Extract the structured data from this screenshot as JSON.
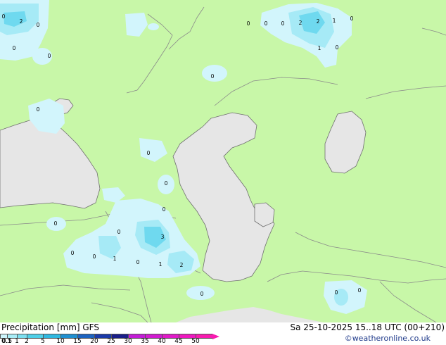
{
  "footer": {
    "title": "Precipitation [mm] GFS",
    "valid": "Sa 25-10-2025 15..18 UTC (00+210)",
    "credit": "©weatheronline.co.uk"
  },
  "legend": {
    "labels": [
      "0.1",
      "0.5",
      "1",
      "2",
      "5",
      "10",
      "15",
      "20",
      "25",
      "30",
      "35",
      "40",
      "45",
      "50"
    ],
    "colors": [
      "#cdf4fb",
      "#a9ecf6",
      "#7ddff0",
      "#4fcfe8",
      "#2fb8e0",
      "#1f8fd0",
      "#1c63c0",
      "#1a3aa8",
      "#1a1e88",
      "#c31dd6",
      "#d11bd0",
      "#e01ac8",
      "#ee19bf",
      "#f81bb0"
    ]
  },
  "colors": {
    "land": "#c8f7a8",
    "sea": "#e6e6e6",
    "border": "#8a8a8a",
    "precip_light": "#d2f5fc",
    "precip_mid": "#a6eaf6",
    "precip_heavy": "#6fd9ef"
  },
  "map": {
    "values": [
      {
        "v": "0"
      },
      {
        "v": "2"
      },
      {
        "v": "0"
      },
      {
        "v": "0"
      },
      {
        "v": "0"
      },
      {
        "v": "0"
      },
      {
        "v": "0"
      },
      {
        "v": "0"
      },
      {
        "v": "2"
      },
      {
        "v": "2"
      },
      {
        "v": "1"
      },
      {
        "v": "0"
      },
      {
        "v": "1"
      },
      {
        "v": "0"
      },
      {
        "v": "0"
      },
      {
        "v": "0"
      },
      {
        "v": "0"
      },
      {
        "v": "0"
      },
      {
        "v": "0"
      },
      {
        "v": "0"
      },
      {
        "v": "0"
      },
      {
        "v": "3"
      },
      {
        "v": "0"
      },
      {
        "v": "0"
      },
      {
        "v": "1"
      },
      {
        "v": "0"
      },
      {
        "v": "1"
      },
      {
        "v": "2"
      },
      {
        "v": "0"
      },
      {
        "v": "0"
      },
      {
        "v": "0"
      }
    ]
  }
}
